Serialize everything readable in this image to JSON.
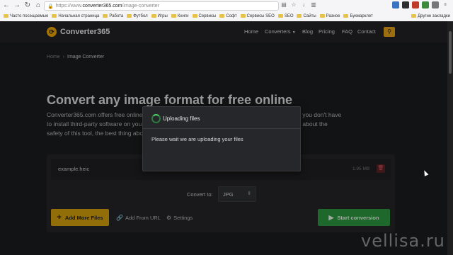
{
  "browser": {
    "url_scheme": "https://www.",
    "url_host": "converter365.com",
    "url_path": "/image-converter",
    "bookmarks": [
      "Часто посещаемые",
      "Начальная страница",
      "Работа",
      "Футбол",
      "Игры",
      "Книги",
      "Сервисы",
      "Софт",
      "Сервисы SEO",
      "SEO",
      "Сайты",
      "Разное",
      "Букмарклет"
    ],
    "other_bookmarks": "Другие закладки"
  },
  "site": {
    "logo": "Converter365",
    "nav": {
      "home": "Home",
      "converters": "Converters",
      "blog": "Blog",
      "pricing": "Pricing",
      "faq": "FAQ",
      "contact": "Contact"
    }
  },
  "breadcrumb": {
    "home": "Home",
    "current": "Image Converter"
  },
  "hero": {
    "title": "Convert any image format for free online",
    "line1": "Converter365.com offers free online                                                               ctical tool to use, as you don't have",
    "line2": "to install third-party software on you                                                            . If you have concerns about the",
    "line3": "safety of this tool, the best thing abo                                                           onversion process."
  },
  "tool": {
    "file_name": "example.heic",
    "file_size": "1.95 MB",
    "convert_to_label": "Convert to:",
    "format_value": "JPG",
    "add_more": "Add More Files",
    "add_url": "Add From URL",
    "settings": "Settings",
    "start": "Start conversion"
  },
  "modal": {
    "title": "Uploading files",
    "message": "Please wait we are uploading your files"
  },
  "watermark": "vellisa.ru"
}
